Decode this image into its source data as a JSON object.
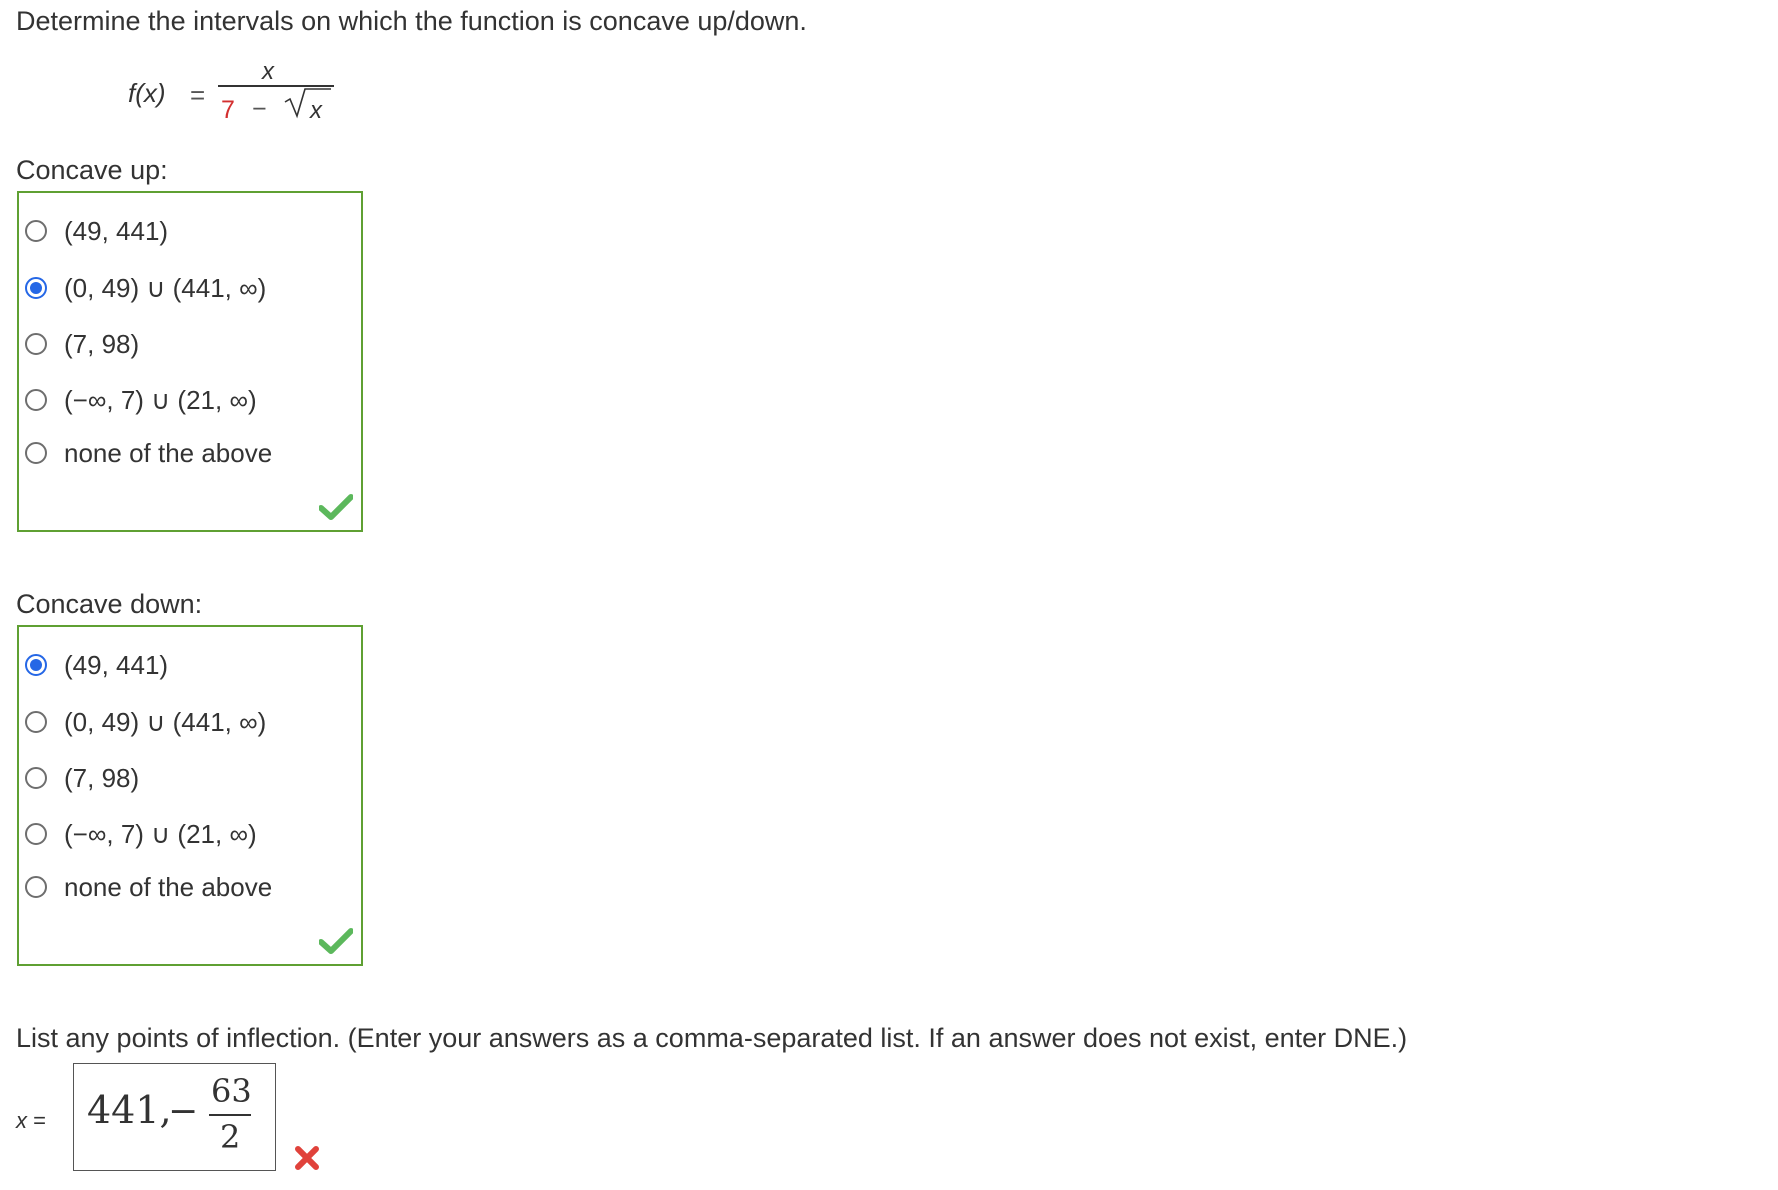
{
  "question": {
    "prompt": "Determine the intervals on which the function is concave up/down.",
    "function": {
      "label": "f(x)",
      "equals": "=",
      "numerator": "x",
      "denominator_constant": "7",
      "denominator_operator": "−",
      "denominator_radicand": "x"
    }
  },
  "concave_up": {
    "label": "Concave up:",
    "selected_index": 1,
    "options": [
      "(49, 441)",
      "(0, 49) ∪ (441, ∞)",
      "(7, 98)",
      "(−∞, 7) ∪ (21, ∞)",
      "none of the above"
    ],
    "feedback": "correct"
  },
  "concave_down": {
    "label": "Concave down:",
    "selected_index": 0,
    "options": [
      "(49, 441)",
      "(0, 49) ∪ (441, ∞)",
      "(7, 98)",
      "(−∞, 7) ∪ (21, ∞)",
      "none of the above"
    ],
    "feedback": "correct"
  },
  "inflection": {
    "prompt": "List any points of inflection. (Enter your answers as a comma-separated list. If an answer does not exist, enter DNE.)",
    "var_label": "x",
    "equals": "=",
    "answer": {
      "first_value": "441,",
      "minus": "−",
      "fraction_numerator": "63",
      "fraction_denominator": "2"
    },
    "feedback": "incorrect"
  },
  "colors": {
    "box_border": "#5fa033",
    "check_green": "#5cb85c",
    "cross_red": "#e0423b",
    "radio_selected": "#2567e6",
    "highlight_red": "#d32f2f"
  }
}
